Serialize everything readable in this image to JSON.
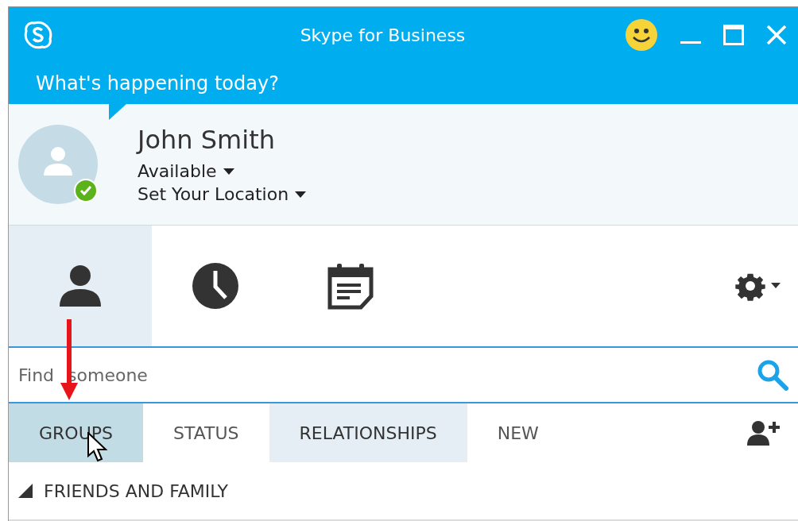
{
  "window": {
    "title": "Skype for Business"
  },
  "mood": {
    "placeholder": "What's happening today?"
  },
  "profile": {
    "name": "John Smith",
    "status": "Available",
    "location": "Set Your Location",
    "available": true
  },
  "nav": [
    {
      "kind": "contacts",
      "selected": true
    },
    {
      "kind": "history",
      "selected": false
    },
    {
      "kind": "meetings",
      "selected": false
    }
  ],
  "search": {
    "placeholder": "Find someone"
  },
  "tabs": [
    {
      "label": "GROUPS",
      "selected": true,
      "highlighted": false
    },
    {
      "label": "STATUS",
      "selected": false,
      "highlighted": false
    },
    {
      "label": "RELATIONSHIPS",
      "selected": false,
      "highlighted": true
    },
    {
      "label": "NEW",
      "selected": false,
      "highlighted": false
    }
  ],
  "groups": [
    {
      "label": "FRIENDS AND FAMILY",
      "expanded": true
    }
  ]
}
